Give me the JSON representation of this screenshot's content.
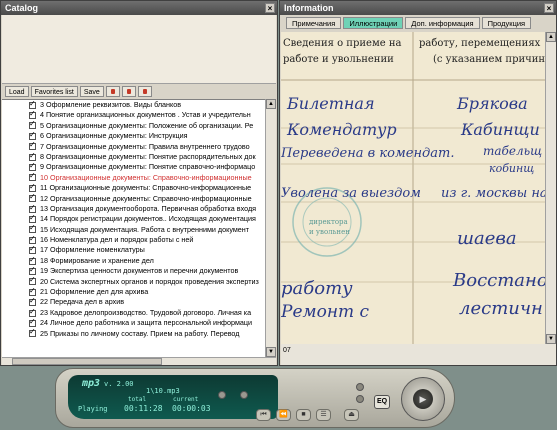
{
  "catalog": {
    "title": "Catalog",
    "close_glyph": "×",
    "toolbar": {
      "load": "Load",
      "favorites": "Favorites list",
      "save": "Save"
    },
    "items": [
      {
        "label": "3 Оформление реквизитов. Виды бланков",
        "checked": true
      },
      {
        "label": "4 Понятие организационных документов . Устав и учредительн",
        "checked": true
      },
      {
        "label": "5 Организационные документы: Положение об организации. Ре",
        "checked": true
      },
      {
        "label": "6 Организационные документы: Инструкция",
        "checked": true
      },
      {
        "label": "7 Организационные документы: Правила внутреннего трудово",
        "checked": true
      },
      {
        "label": "8 Организационные документы: Понятие распорядительных док",
        "checked": true
      },
      {
        "label": "9 Организационные документы: Понятие справочно-информацо",
        "checked": true
      },
      {
        "label": "10 Организационные документы: Справочно-информационные",
        "checked": true,
        "selected": true
      },
      {
        "label": "11 Организационные документы: Справочно-информационные",
        "checked": true
      },
      {
        "label": "12 Организационные документы: Справочно-информационные",
        "checked": true
      },
      {
        "label": "13 Организация документооборота. Первичная обработка входя",
        "checked": true
      },
      {
        "label": "14 Порядок регистрации документов.. Исходящая документация",
        "checked": true
      },
      {
        "label": "15 Исходящая документация. Работа с внутренними документ",
        "checked": true
      },
      {
        "label": "16 Номенклатура дел и порядок работы с ней",
        "checked": true
      },
      {
        "label": "17 Оформление номенклатуры",
        "checked": true
      },
      {
        "label": "18 Формирование и хранение дел",
        "checked": true
      },
      {
        "label": "19 Экспертиза ценности документов и перечни документов",
        "checked": true
      },
      {
        "label": "20 Система экспертных органов и порядок проведения экспертиз",
        "checked": true
      },
      {
        "label": "21 Оформление дел для архива",
        "checked": true
      },
      {
        "label": "22 Передача дел в архив",
        "checked": true
      },
      {
        "label": "23 Кадровое делопроизводство. Трудовой договоро. Личная ка",
        "checked": true
      },
      {
        "label": "24 Личное дело работника и защита персональной информаци",
        "checked": true
      },
      {
        "label": "25 Приказы по личному составу. Прием на работу. Перевод",
        "checked": true
      }
    ]
  },
  "info": {
    "title": "Information",
    "close_glyph": "×",
    "tabs": [
      {
        "label": "Примечания",
        "active": false
      },
      {
        "label": "Иллюстрации",
        "active": true
      },
      {
        "label": "Доп. информация",
        "active": false
      },
      {
        "label": "Продукция",
        "active": false
      }
    ],
    "doc": {
      "print_lines": [
        "Сведения о приеме на",
        "работе и увольнении",
        "работу, перемещениях",
        "(с указанием причин)"
      ],
      "hand_lines": [
        "Билетная",
        "Комендатур",
        "Переведена в комендат.",
        "Уволена за выездом",
        "Брякова",
        "Кабинщи",
        "табельщ",
        "кобинщ",
        "из г. москвы на",
        "шаева",
        "Восстано",
        "лестичн",
        "работу",
        "Ремонт с"
      ],
      "stamp": [
        "директора",
        "и увольнен"
      ]
    },
    "status": "07"
  },
  "player": {
    "logo": "mp3",
    "version": "v. 2.00",
    "track": "1\\10.mp3",
    "status": "Playing",
    "total_label": "total",
    "total_time": "00:11:28",
    "current_label": "current",
    "current_time": "00:00:03",
    "eq_label": "EQ",
    "play_glyph": "▶"
  },
  "colors": {
    "selected_text": "#d03030",
    "active_tab": "#6fd2b6",
    "lcd_bg": "#0f5a4f",
    "lcd_text": "#8ff0da",
    "ink": "#2a3a88"
  }
}
